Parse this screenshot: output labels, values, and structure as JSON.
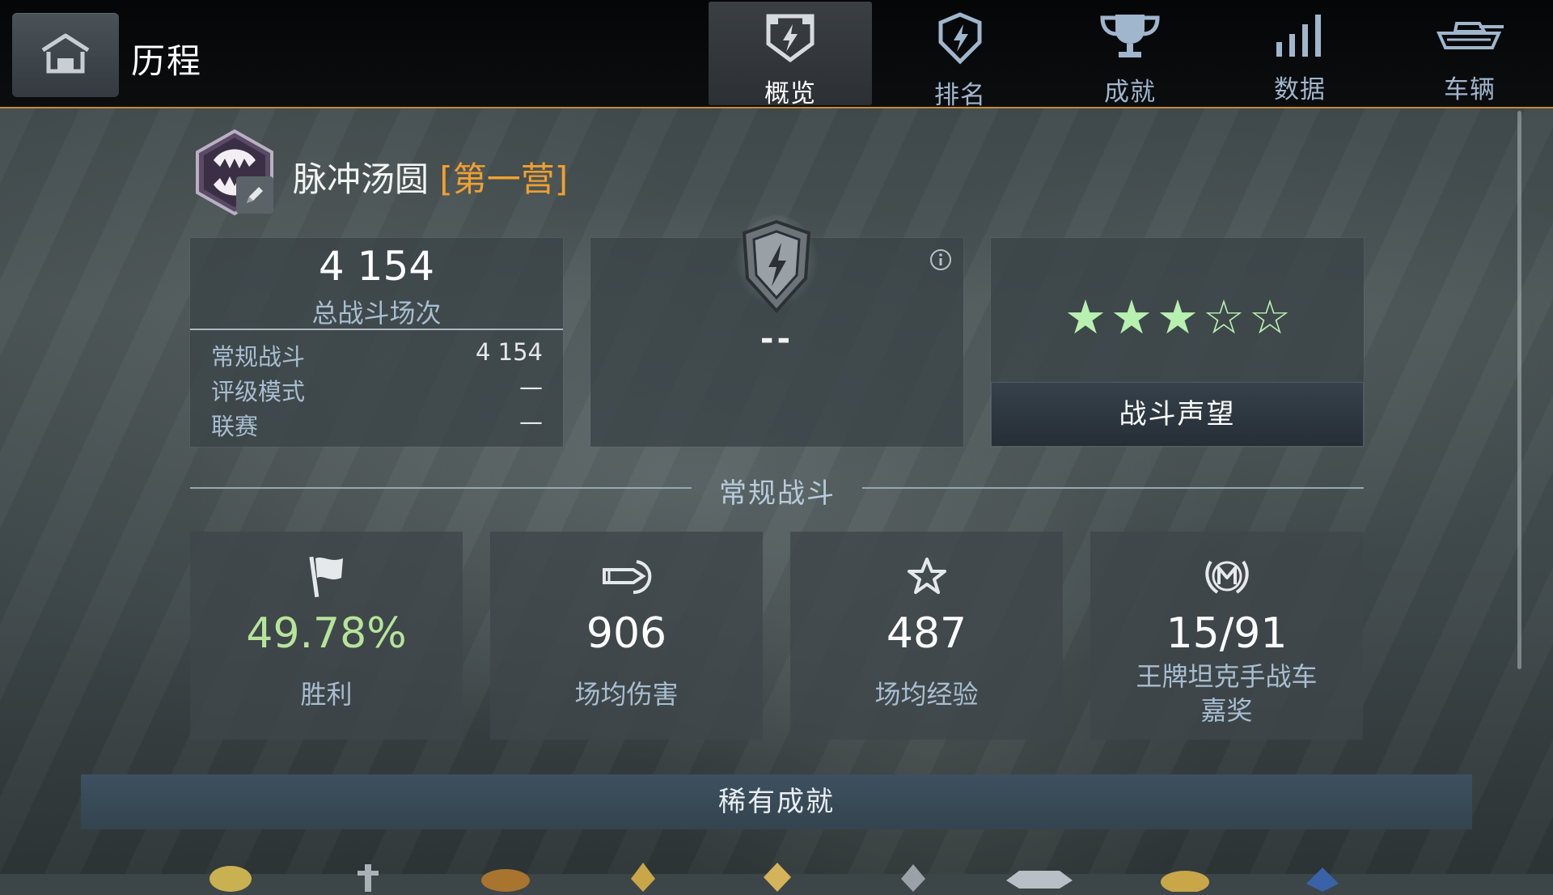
{
  "header": {
    "title": "历程",
    "home_icon": "hangar-home-icon",
    "tabs": [
      {
        "label": "概览",
        "icon": "shield-lightning-icon",
        "active": true
      },
      {
        "label": "排名",
        "icon": "rank-badge-icon",
        "active": false
      },
      {
        "label": "成就",
        "icon": "trophy-icon",
        "active": false
      },
      {
        "label": "数据",
        "icon": "bar-stats-icon",
        "active": false
      },
      {
        "label": "车辆",
        "icon": "tank-icon",
        "active": false
      }
    ]
  },
  "player": {
    "name": "脉冲汤圆",
    "clan": "[第一营]",
    "emblem_icon": "fangs-emblem-icon",
    "edit_icon": "pencil-icon"
  },
  "battles": {
    "total": "4 154",
    "total_label": "总战斗场次",
    "rows": [
      {
        "label": "常规战斗",
        "value": "4 154"
      },
      {
        "label": "评级模式",
        "value": "—"
      },
      {
        "label": "联赛",
        "value": "—"
      }
    ]
  },
  "rank": {
    "value": "--",
    "emblem_icon": "rank-shield-icon",
    "info_icon": "info-icon"
  },
  "mastery": {
    "stars_filled": 3,
    "stars_total": 5,
    "button_label": "战斗声望"
  },
  "section": {
    "title": "常规战斗"
  },
  "stats": [
    {
      "value": "49.78%",
      "label": "胜利",
      "icon": "flag-icon",
      "highlight": true
    },
    {
      "value": "906",
      "label": "场均伤害",
      "icon": "shell-icon",
      "highlight": false
    },
    {
      "value": "487",
      "label": "场均经验",
      "icon": "star-outline-icon",
      "highlight": false
    },
    {
      "value": "15/91",
      "label": "王牌坦克手战车嘉奖",
      "label_line1": "王牌坦克手战车",
      "label_line2": "嘉奖",
      "icon": "mastery-m-icon",
      "highlight": false
    }
  ],
  "rare": {
    "title": "稀有成就"
  },
  "colors": {
    "accent": "#c98a2e",
    "clan": "#f0a030",
    "win_rate": "#b6e59a",
    "label": "#a8bdd0",
    "star": "#b8f0b0"
  }
}
